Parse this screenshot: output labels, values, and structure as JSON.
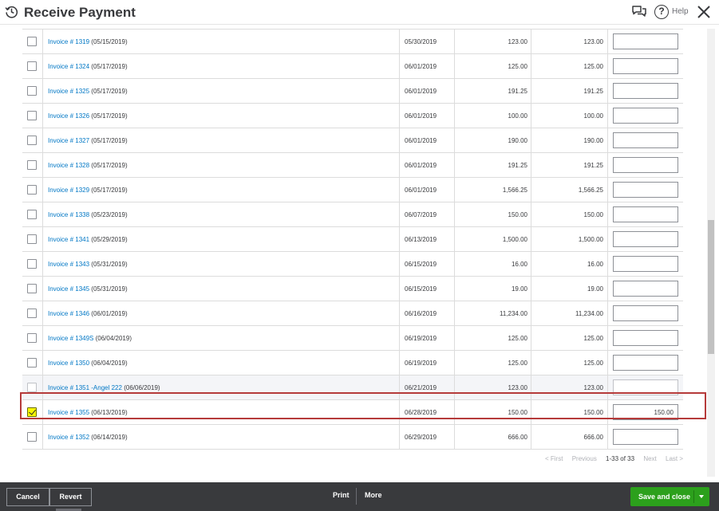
{
  "header": {
    "title": "Receive Payment",
    "help_label": "Help",
    "help_glyph": "?"
  },
  "rows": [
    {
      "link": "Invoice # 1319",
      "date": "(05/15/2019)",
      "due": "05/30/2019",
      "original": "123.00",
      "open": "123.00",
      "payment": "",
      "checked": false,
      "gray": false
    },
    {
      "link": "Invoice # 1324",
      "date": "(05/17/2019)",
      "due": "06/01/2019",
      "original": "125.00",
      "open": "125.00",
      "payment": "",
      "checked": false,
      "gray": false
    },
    {
      "link": "Invoice # 1325",
      "date": "(05/17/2019)",
      "due": "06/01/2019",
      "original": "191.25",
      "open": "191.25",
      "payment": "",
      "checked": false,
      "gray": false
    },
    {
      "link": "Invoice # 1326",
      "date": "(05/17/2019)",
      "due": "06/01/2019",
      "original": "100.00",
      "open": "100.00",
      "payment": "",
      "checked": false,
      "gray": false
    },
    {
      "link": "Invoice # 1327",
      "date": "(05/17/2019)",
      "due": "06/01/2019",
      "original": "190.00",
      "open": "190.00",
      "payment": "",
      "checked": false,
      "gray": false
    },
    {
      "link": "Invoice # 1328",
      "date": "(05/17/2019)",
      "due": "06/01/2019",
      "original": "191.25",
      "open": "191.25",
      "payment": "",
      "checked": false,
      "gray": false
    },
    {
      "link": "Invoice # 1329",
      "date": "(05/17/2019)",
      "due": "06/01/2019",
      "original": "1,566.25",
      "open": "1,566.25",
      "payment": "",
      "checked": false,
      "gray": false
    },
    {
      "link": "Invoice # 1338",
      "date": "(05/23/2019)",
      "due": "06/07/2019",
      "original": "150.00",
      "open": "150.00",
      "payment": "",
      "checked": false,
      "gray": false
    },
    {
      "link": "Invoice # 1341",
      "date": "(05/29/2019)",
      "due": "06/13/2019",
      "original": "1,500.00",
      "open": "1,500.00",
      "payment": "",
      "checked": false,
      "gray": false
    },
    {
      "link": "Invoice # 1343",
      "date": "(05/31/2019)",
      "due": "06/15/2019",
      "original": "16.00",
      "open": "16.00",
      "payment": "",
      "checked": false,
      "gray": false
    },
    {
      "link": "Invoice # 1345",
      "date": "(05/31/2019)",
      "due": "06/15/2019",
      "original": "19.00",
      "open": "19.00",
      "payment": "",
      "checked": false,
      "gray": false
    },
    {
      "link": "Invoice # 1346",
      "date": "(06/01/2019)",
      "due": "06/16/2019",
      "original": "11,234.00",
      "open": "11,234.00",
      "payment": "",
      "checked": false,
      "gray": false
    },
    {
      "link": "Invoice # 1349S",
      "date": "(06/04/2019)",
      "due": "06/19/2019",
      "original": "125.00",
      "open": "125.00",
      "payment": "",
      "checked": false,
      "gray": false
    },
    {
      "link": "Invoice # 1350",
      "date": "(06/04/2019)",
      "due": "06/19/2019",
      "original": "125.00",
      "open": "125.00",
      "payment": "",
      "checked": false,
      "gray": false
    },
    {
      "link": "Invoice # 1351 -Angel 222",
      "date": "(06/06/2019)",
      "due": "06/21/2019",
      "original": "123.00",
      "open": "123.00",
      "payment": "",
      "checked": false,
      "gray": true
    },
    {
      "link": "Invoice # 1355",
      "date": "(06/13/2019)",
      "due": "06/28/2019",
      "original": "150.00",
      "open": "150.00",
      "payment": "150.00",
      "checked": true,
      "gray": false
    },
    {
      "link": "Invoice # 1352",
      "date": "(06/14/2019)",
      "due": "06/29/2019",
      "original": "666.00",
      "open": "666.00",
      "payment": "",
      "checked": false,
      "gray": false
    }
  ],
  "pager": {
    "first": "< First",
    "previous": "Previous",
    "count": "1-33 of 33",
    "next": "Next",
    "last": "Last >"
  },
  "footer": {
    "cancel": "Cancel",
    "revert": "Revert",
    "print": "Print",
    "more": "More",
    "save": "Save and close"
  },
  "colors": {
    "link": "#0077c5",
    "save_green": "#2ca01c",
    "footer_bg": "#393a3d",
    "highlight_red": "#b53a3a",
    "checkbox_highlight": "#f7f700"
  },
  "icons": {
    "history": "history-icon",
    "feedback": "feedback-icon",
    "help": "help-icon",
    "close": "close-icon",
    "checkbox": "checkbox-icon",
    "save_caret": "caret-down-icon"
  }
}
